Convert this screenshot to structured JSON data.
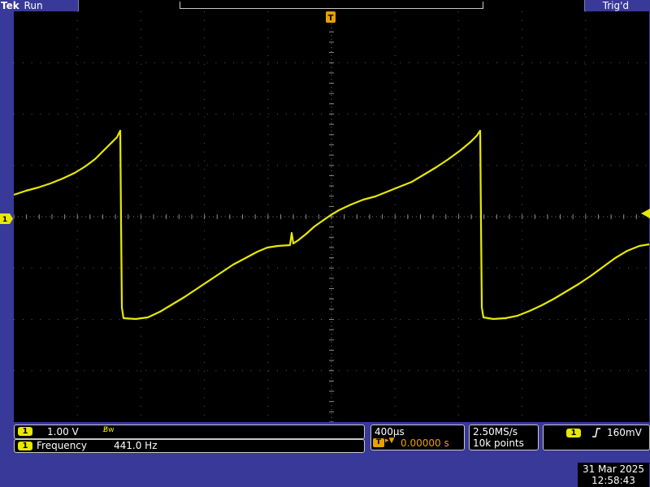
{
  "status": {
    "brand": "Tek",
    "state": "Run",
    "trigger_state": "Trig'd"
  },
  "markers": {
    "channel": "1",
    "trigger": "T"
  },
  "readouts": {
    "channel_scale": {
      "channel": "1",
      "value": "1.00 V",
      "bandwidth": "B̸w"
    },
    "measurement": {
      "channel": "1",
      "label": "Frequency",
      "value": "441.0 Hz"
    },
    "horizontal": {
      "timebase": "400µs",
      "trigger_badge": "T",
      "position": "0.00000 s"
    },
    "acquisition": {
      "sample_rate": "2.50MS/s",
      "record_length": "10k points"
    },
    "trigger": {
      "channel": "1",
      "slope_icon": "rising-edge-icon",
      "level": "160mV"
    }
  },
  "datetime": {
    "date": "31 Mar  2025",
    "time": "12:58:43"
  },
  "colors": {
    "trace": "#e8e800",
    "background": "#39399a",
    "screen": "#000000",
    "trigger_marker": "#e8a000"
  }
}
